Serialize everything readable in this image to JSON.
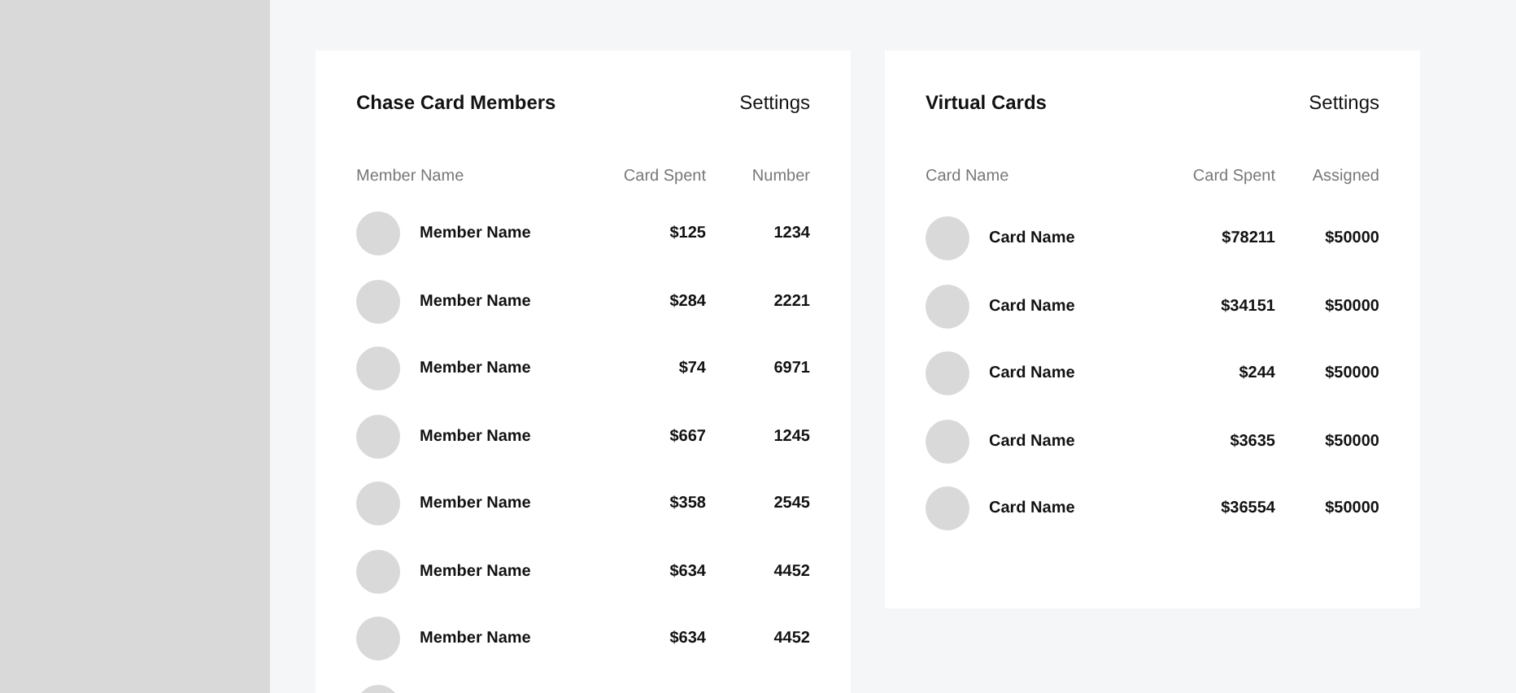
{
  "panels": [
    {
      "title": "Chase Card Members",
      "action": "Settings",
      "columns": [
        "Member Name",
        "Card Spent",
        "Number"
      ],
      "rows": [
        {
          "name": "Member Name",
          "spent": "$125",
          "value": "1234"
        },
        {
          "name": "Member Name",
          "spent": "$284",
          "value": "2221"
        },
        {
          "name": "Member Name",
          "spent": "$74",
          "value": "6971"
        },
        {
          "name": "Member Name",
          "spent": "$667",
          "value": "1245"
        },
        {
          "name": "Member Name",
          "spent": "$358",
          "value": "2545"
        },
        {
          "name": "Member Name",
          "spent": "$634",
          "value": "4452"
        },
        {
          "name": "Member Name",
          "spent": "$634",
          "value": "4452"
        }
      ],
      "more_below": true
    },
    {
      "title": "Virtual Cards",
      "action": "Settings",
      "columns": [
        "Card Name",
        "Card Spent",
        "Assigned"
      ],
      "rows": [
        {
          "name": "Card Name",
          "spent": "$78211",
          "value": "$50000"
        },
        {
          "name": "Card Name",
          "spent": "$34151",
          "value": "$50000"
        },
        {
          "name": "Card Name",
          "spent": "$244",
          "value": "$50000"
        },
        {
          "name": "Card Name",
          "spent": "$3635",
          "value": "$50000"
        },
        {
          "name": "Card Name",
          "spent": "$36554",
          "value": "$50000"
        }
      ],
      "more_below": false
    }
  ]
}
